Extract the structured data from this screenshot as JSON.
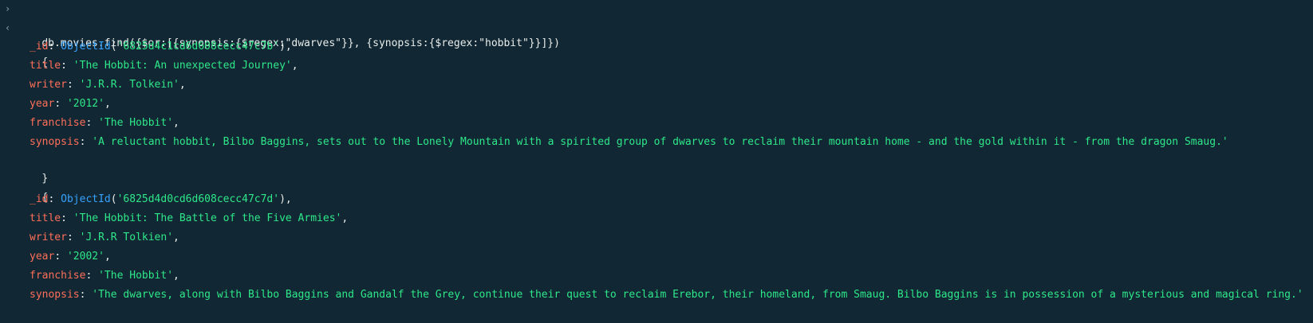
{
  "command": "db.movies.find({$or:[{synopsis:{$regex:\"dwarves\"}}, {synopsis:{$regex:\"hobbit\"}}]})",
  "prompt_glyph": "›",
  "result_glyph": "‹",
  "documents": [
    {
      "_id": "ObjectId",
      "_id_value": "'6825d4c1cd6d608cecc47c7b'",
      "title": "'The Hobbit: An unexpected Journey'",
      "writer": "'J.R.R. Tolkein'",
      "year": "'2012'",
      "franchise": "'The Hobbit'",
      "synopsis": "'A reluctant hobbit, Bilbo Baggins, sets out to the Lonely Mountain with a spirited group of dwarves to reclaim their mountain home - and the gold within it - from the dragon Smaug.'"
    },
    {
      "_id": "ObjectId",
      "_id_value": "'6825d4d0cd6d608cecc47c7d'",
      "title": "'The Hobbit: The Battle of the Five Armies'",
      "writer": "'J.R.R Tolkien'",
      "year": "'2002'",
      "franchise": "'The Hobbit'",
      "synopsis": "'The dwarves, along with Bilbo Baggins and Gandalf the Grey, continue their quest to reclaim Erebor, their homeland, from Smaug. Bilbo Baggins is in possession of a mysterious and magical ring.'"
    }
  ],
  "labels": {
    "id_key": "_id",
    "title_key": "title",
    "writer_key": "writer",
    "year_key": "year",
    "franchise_key": "franchise",
    "synopsis_key": "synopsis",
    "open_brace": "{",
    "close_brace": "}"
  },
  "colors": {
    "background": "#112733",
    "key": "#ff6f59",
    "string": "#2ee88a",
    "function": "#36a3ff",
    "text": "#e8edeb"
  }
}
